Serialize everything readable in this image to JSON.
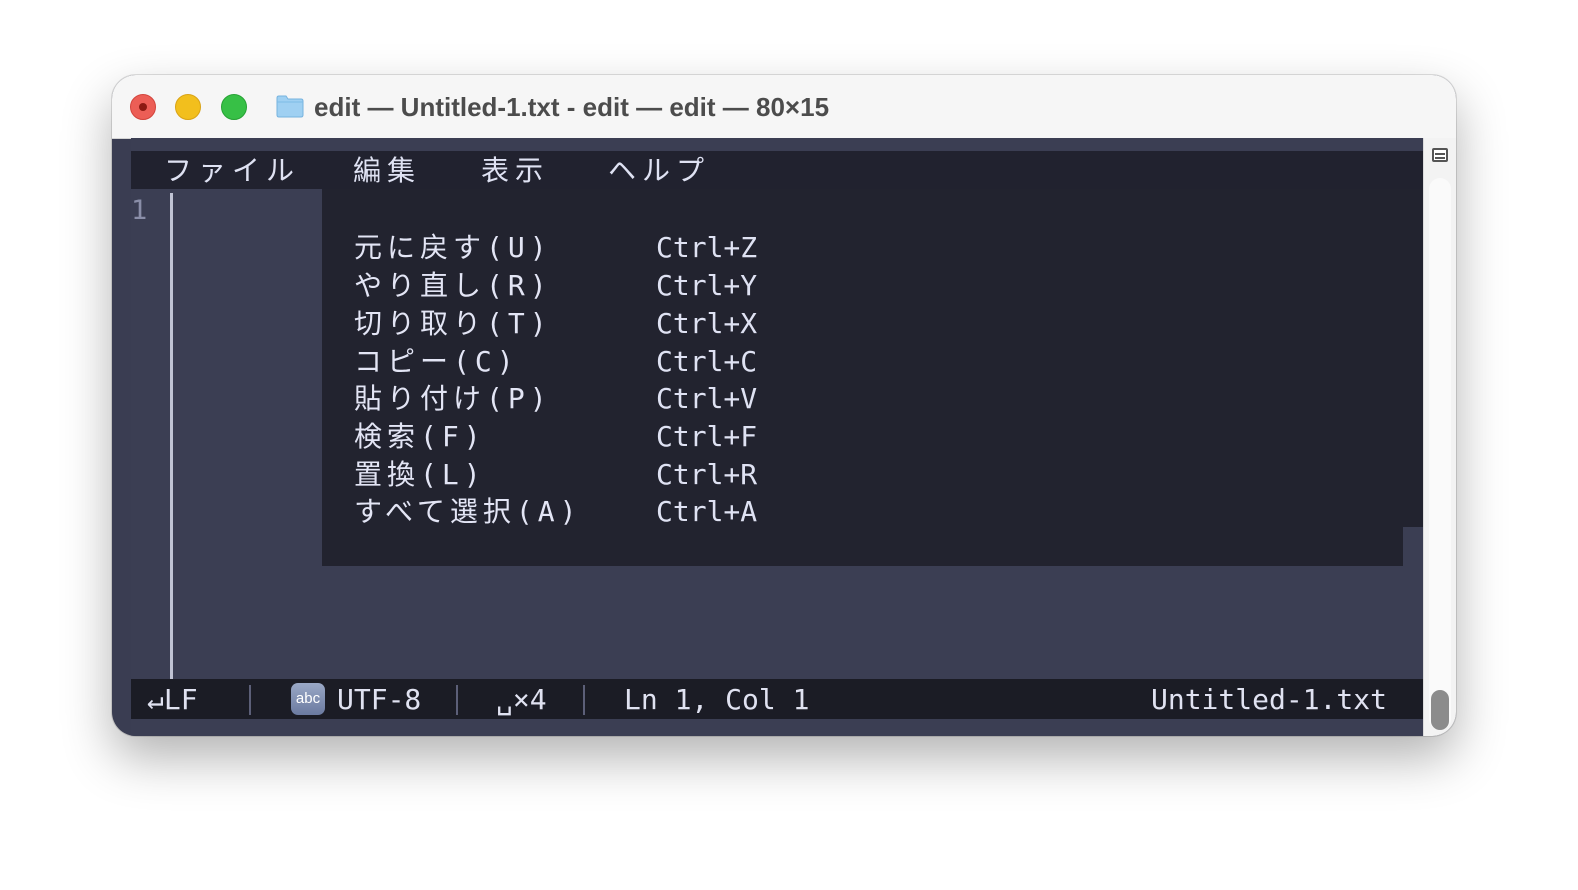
{
  "window": {
    "title": "edit — Untitled-1.txt - edit — edit — 80×15"
  },
  "menubar": {
    "items": [
      {
        "label": "ファイル"
      },
      {
        "label": "編集"
      },
      {
        "label": "表示"
      },
      {
        "label": "ヘルプ"
      }
    ]
  },
  "editor": {
    "line_numbers": [
      "1"
    ]
  },
  "edit_menu": {
    "items": [
      {
        "label": "元に戻す(U)",
        "shortcut": "Ctrl+Z"
      },
      {
        "label": "やり直し(R)",
        "shortcut": "Ctrl+Y"
      },
      {
        "label": "切り取り(T)",
        "shortcut": "Ctrl+X"
      },
      {
        "label": "コピー(C)",
        "shortcut": "Ctrl+C"
      },
      {
        "label": "貼り付け(P)",
        "shortcut": "Ctrl+V"
      },
      {
        "label": "検索(F)",
        "shortcut": "Ctrl+F"
      },
      {
        "label": "置換(L)",
        "shortcut": "Ctrl+R"
      },
      {
        "label": "すべて選択(A)",
        "shortcut": "Ctrl+A"
      }
    ]
  },
  "statusbar": {
    "line_ending": "↵LF",
    "encoding_icon": "abc",
    "encoding": "UTF-8",
    "indent": "␣×4",
    "cursor": "Ln 1, Col 1",
    "filename": "Untitled-1.txt"
  },
  "colors": {
    "terminal_bg": "#3b3e53",
    "menu_bg": "#21222f",
    "status_bg": "#1b1c25",
    "text": "#dde0f2"
  },
  "icons": {
    "close": "close-icon",
    "minimize": "minimize-icon",
    "zoom": "zoom-icon",
    "folder": "folder-icon",
    "scroll_button": "scroll-marker-icon"
  }
}
